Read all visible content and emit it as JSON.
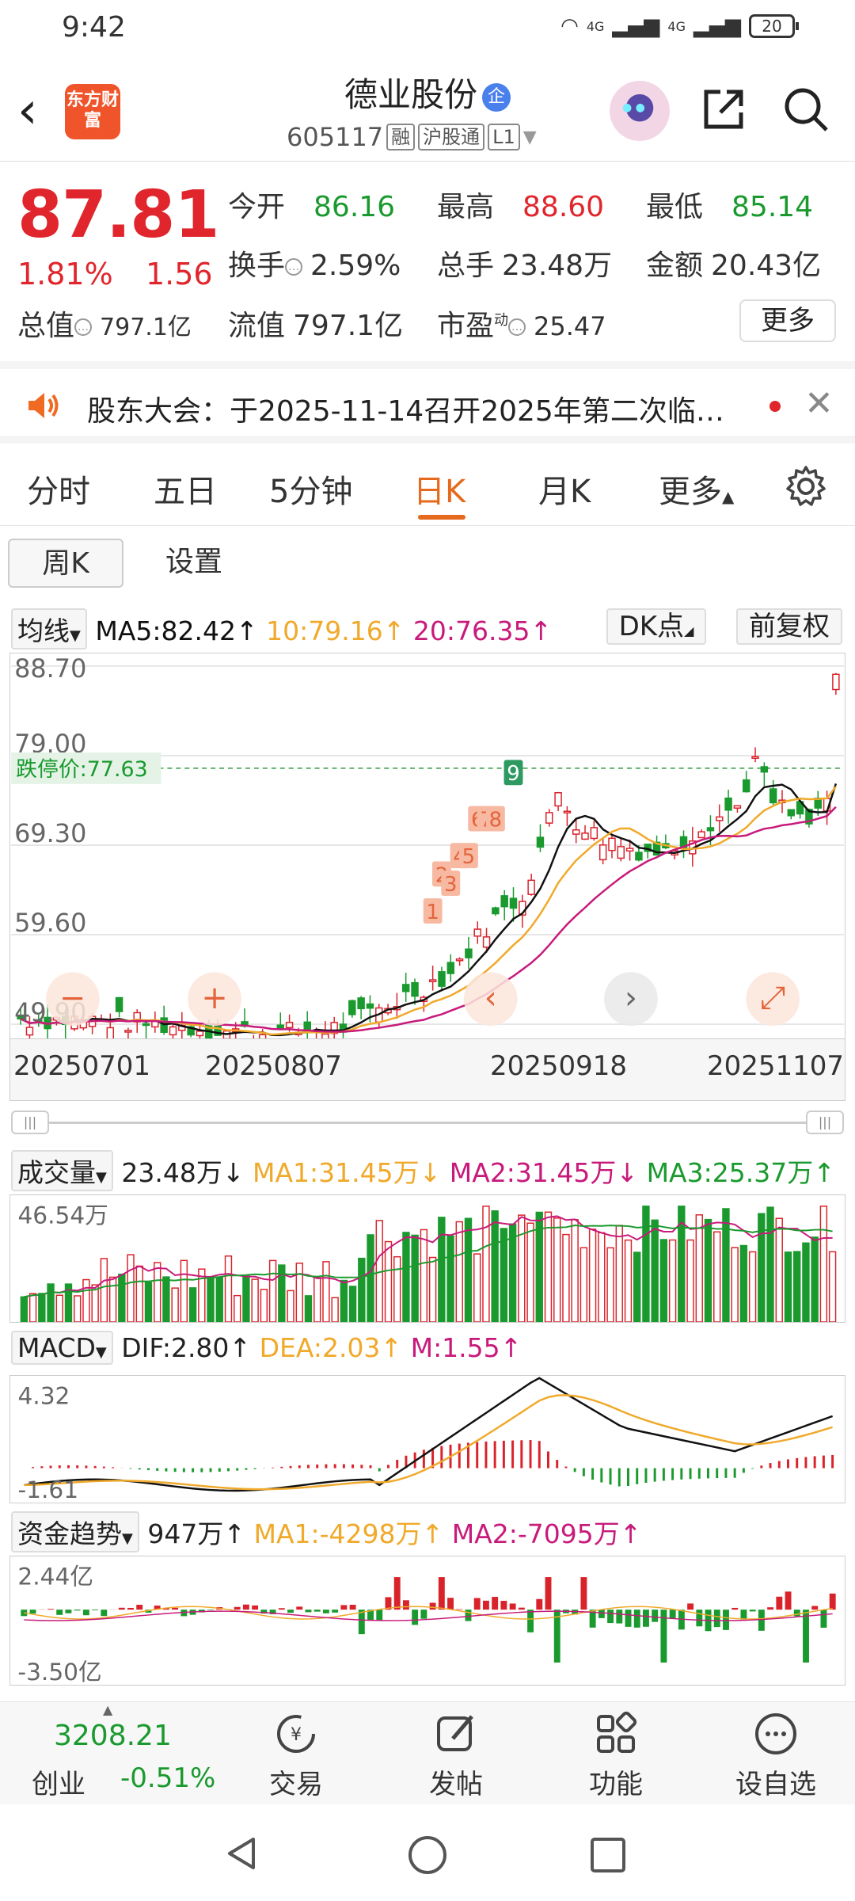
{
  "status": {
    "time": "9:42",
    "battery": "20",
    "net1": "4G",
    "net2": "4G"
  },
  "header": {
    "logo": "东方财富",
    "name": "德业股份",
    "badge": "企",
    "code": "605117",
    "tag1": "融",
    "tag2": "沪股通",
    "tag3": "L1"
  },
  "quote": {
    "price": "87.81",
    "pct": "1.81%",
    "change": "1.56",
    "open_label": "今开",
    "open": "86.16",
    "high_label": "最高",
    "high": "88.60",
    "low_label": "最低",
    "low": "85.14",
    "turnover_label": "换手",
    "turnover": "2.59%",
    "vol_label": "总手",
    "vol": "23.48万",
    "amount_label": "金额",
    "amount": "20.43亿",
    "mcap_label": "总值",
    "mcap": "797.1亿",
    "float_label": "流值",
    "float": "797.1亿",
    "pe_label": "市盈",
    "pe_sup": "动",
    "pe": "25.47",
    "more": "更多"
  },
  "notice": {
    "text": "股东大会：于2025-11-14召开2025年第二次临…"
  },
  "tabs": [
    "分时",
    "五日",
    "5分钟",
    "日K",
    "月K",
    "更多"
  ],
  "subtabs": [
    "周K",
    "设置"
  ],
  "kline": {
    "ind": "均线",
    "ma5": "MA5:82.42↑",
    "ma10": "10:79.16↑",
    "ma20": "20:76.35↑",
    "dk": "DK点",
    "fq": "前复权",
    "yticks": [
      "88.70",
      "79.00",
      "69.30",
      "59.60",
      "49.90"
    ],
    "limit_down": "跌停价:77.63",
    "dates": [
      "20250701",
      "20250807",
      "20250918",
      "20251107"
    ],
    "markers": [
      "1",
      "2",
      "3",
      "4",
      "5",
      "6",
      "7",
      "8",
      "9"
    ],
    "colors": {
      "up": "#d9232b",
      "down": "#1a9a2e",
      "ma5": "#111111",
      "ma10": "#f0a92a",
      "ma20": "#c81a7b"
    }
  },
  "volume": {
    "ind": "成交量",
    "cur": "23.48万↓",
    "ma1": "MA1:31.45万↓",
    "ma2": "MA2:31.45万↓",
    "ma3": "MA3:25.37万↑",
    "ytop": "46.54万"
  },
  "macd": {
    "ind": "MACD",
    "dif": "DIF:2.80↑",
    "dea": "DEA:2.03↑",
    "m": "M:1.55↑",
    "ytop": "4.32",
    "ybot": "-1.61"
  },
  "fund": {
    "ind": "资金趋势",
    "cur": "947万↑",
    "ma1": "MA1:-4298万↑",
    "ma2": "MA2:-7095万↑",
    "ytop": "2.44亿",
    "ybot": "-3.50亿"
  },
  "bottom": {
    "index_value": "3208.21",
    "index_name": "创业",
    "index_pct": "-0.51%",
    "trade": "交易",
    "post": "发帖",
    "func": "功能",
    "watch": "设自选"
  }
}
